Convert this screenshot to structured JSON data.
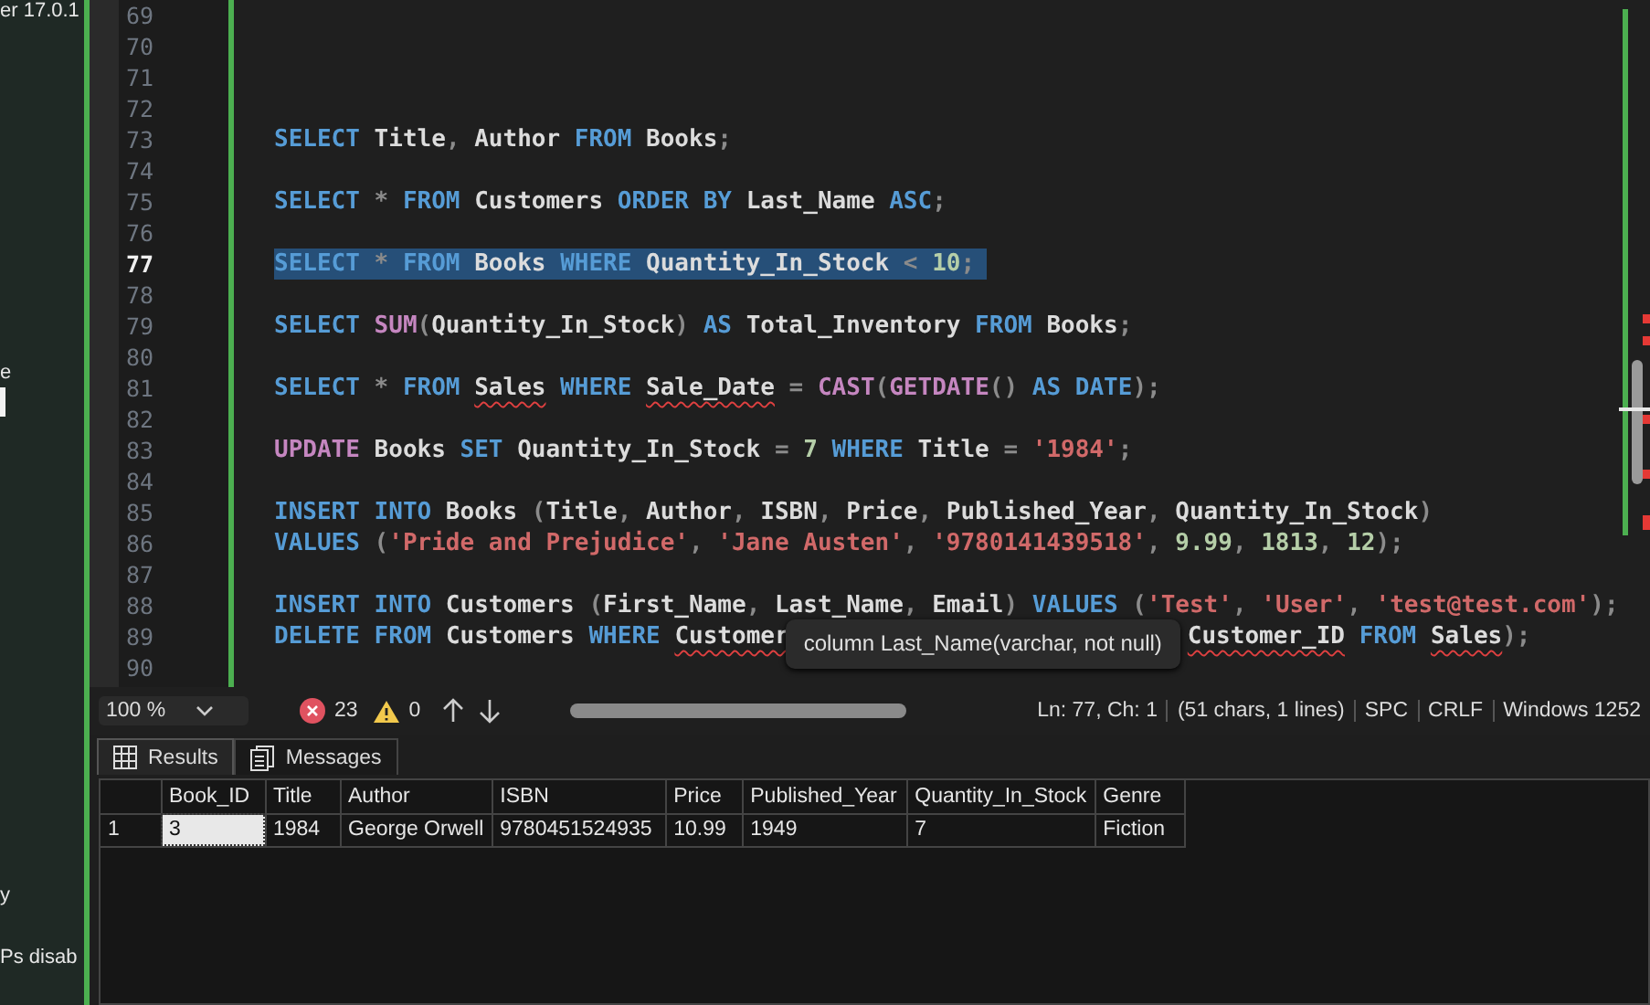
{
  "side_panel": {
    "texts": [
      "er 17.0.1",
      "e",
      "y",
      "Ps disab"
    ]
  },
  "editor": {
    "lines": [
      {
        "number": "69",
        "selected": false
      },
      {
        "number": "70",
        "selected": false
      },
      {
        "number": "71",
        "selected": false
      },
      {
        "number": "72",
        "selected": false
      },
      {
        "number": "73",
        "selected": false,
        "tokens": [
          {
            "text": "SELECT ",
            "kind": "kw"
          },
          {
            "text": "Title",
            "kind": "id"
          },
          {
            "text": ", ",
            "kind": "op"
          },
          {
            "text": "Author ",
            "kind": "id"
          },
          {
            "text": "FROM ",
            "kind": "kw"
          },
          {
            "text": "Books",
            "kind": "id"
          },
          {
            "text": ";",
            "kind": "op"
          }
        ]
      },
      {
        "number": "74",
        "selected": false
      },
      {
        "number": "75",
        "selected": false,
        "tokens": [
          {
            "text": "SELECT ",
            "kind": "kw"
          },
          {
            "text": "* ",
            "kind": "op"
          },
          {
            "text": "FROM ",
            "kind": "kw"
          },
          {
            "text": "Customers ",
            "kind": "id"
          },
          {
            "text": "ORDER BY ",
            "kind": "kw"
          },
          {
            "text": "Last_Name ",
            "kind": "id"
          },
          {
            "text": "ASC",
            "kind": "kw"
          },
          {
            "text": ";",
            "kind": "op"
          }
        ]
      },
      {
        "number": "76",
        "selected": false
      },
      {
        "number": "77",
        "selected": true,
        "tokens": [
          {
            "text": "SELECT ",
            "kind": "kw"
          },
          {
            "text": "* ",
            "kind": "op"
          },
          {
            "text": "FROM ",
            "kind": "kw"
          },
          {
            "text": "Books ",
            "kind": "id"
          },
          {
            "text": "WHERE ",
            "kind": "kw"
          },
          {
            "text": "Quantity_In_Stock ",
            "kind": "id"
          },
          {
            "text": "< ",
            "kind": "op"
          },
          {
            "text": "10",
            "kind": "num"
          },
          {
            "text": ";",
            "kind": "op"
          }
        ]
      },
      {
        "number": "78",
        "selected": false
      },
      {
        "number": "79",
        "selected": false,
        "tokens": [
          {
            "text": "SELECT ",
            "kind": "kw"
          },
          {
            "text": "SUM",
            "kind": "fn"
          },
          {
            "text": "(",
            "kind": "op"
          },
          {
            "text": "Quantity_In_Stock",
            "kind": "id"
          },
          {
            "text": ") ",
            "kind": "op"
          },
          {
            "text": "AS ",
            "kind": "kw"
          },
          {
            "text": "Total_Inventory ",
            "kind": "id"
          },
          {
            "text": "FROM ",
            "kind": "kw"
          },
          {
            "text": "Books",
            "kind": "id"
          },
          {
            "text": ";",
            "kind": "op"
          }
        ]
      },
      {
        "number": "80",
        "selected": false
      },
      {
        "number": "81",
        "selected": false,
        "tokens": [
          {
            "text": "SELECT ",
            "kind": "kw"
          },
          {
            "text": "* ",
            "kind": "op"
          },
          {
            "text": "FROM ",
            "kind": "kw"
          },
          {
            "text": "Sales",
            "kind": "id",
            "squiggle": true
          },
          {
            "text": " WHERE ",
            "kind": "kw"
          },
          {
            "text": "Sale_Date",
            "kind": "id",
            "squiggle": true
          },
          {
            "text": " = ",
            "kind": "op"
          },
          {
            "text": "CAST",
            "kind": "fn"
          },
          {
            "text": "(",
            "kind": "op"
          },
          {
            "text": "GETDATE",
            "kind": "fn"
          },
          {
            "text": "() ",
            "kind": "op"
          },
          {
            "text": "AS DATE",
            "kind": "kw"
          },
          {
            "text": ");",
            "kind": "op"
          }
        ]
      },
      {
        "number": "82",
        "selected": false
      },
      {
        "number": "83",
        "selected": false,
        "tokens": [
          {
            "text": "UPDATE ",
            "kind": "fn"
          },
          {
            "text": "Books ",
            "kind": "id"
          },
          {
            "text": "SET ",
            "kind": "kw"
          },
          {
            "text": "Quantity_In_Stock ",
            "kind": "id"
          },
          {
            "text": "= ",
            "kind": "op"
          },
          {
            "text": "7 ",
            "kind": "num"
          },
          {
            "text": "WHERE ",
            "kind": "kw"
          },
          {
            "text": "Title ",
            "kind": "id"
          },
          {
            "text": "= ",
            "kind": "op"
          },
          {
            "text": "'1984'",
            "kind": "str"
          },
          {
            "text": ";",
            "kind": "op"
          }
        ]
      },
      {
        "number": "84",
        "selected": false
      },
      {
        "number": "85",
        "selected": false,
        "tokens": [
          {
            "text": "INSERT INTO ",
            "kind": "kw"
          },
          {
            "text": "Books ",
            "kind": "id"
          },
          {
            "text": "(",
            "kind": "op"
          },
          {
            "text": "Title",
            "kind": "id"
          },
          {
            "text": ", ",
            "kind": "op"
          },
          {
            "text": "Author",
            "kind": "id"
          },
          {
            "text": ", ",
            "kind": "op"
          },
          {
            "text": "ISBN",
            "kind": "id"
          },
          {
            "text": ", ",
            "kind": "op"
          },
          {
            "text": "Price",
            "kind": "id"
          },
          {
            "text": ", ",
            "kind": "op"
          },
          {
            "text": "Published_Year",
            "kind": "id"
          },
          {
            "text": ", ",
            "kind": "op"
          },
          {
            "text": "Quantity_In_Stock",
            "kind": "id"
          },
          {
            "text": ")",
            "kind": "op"
          }
        ]
      },
      {
        "number": "86",
        "selected": false,
        "tokens": [
          {
            "text": "VALUES ",
            "kind": "kw"
          },
          {
            "text": "(",
            "kind": "op"
          },
          {
            "text": "'Pride and Prejudice'",
            "kind": "str"
          },
          {
            "text": ", ",
            "kind": "op"
          },
          {
            "text": "'Jane Austen'",
            "kind": "str"
          },
          {
            "text": ", ",
            "kind": "op"
          },
          {
            "text": "'9780141439518'",
            "kind": "str"
          },
          {
            "text": ", ",
            "kind": "op"
          },
          {
            "text": "9.99",
            "kind": "num"
          },
          {
            "text": ", ",
            "kind": "op"
          },
          {
            "text": "1813",
            "kind": "num"
          },
          {
            "text": ", ",
            "kind": "op"
          },
          {
            "text": "12",
            "kind": "num"
          },
          {
            "text": ");",
            "kind": "op"
          }
        ]
      },
      {
        "number": "87",
        "selected": false
      },
      {
        "number": "88",
        "selected": false,
        "tokens": [
          {
            "text": "INSERT INTO ",
            "kind": "kw"
          },
          {
            "text": "Customers ",
            "kind": "id"
          },
          {
            "text": "(",
            "kind": "op"
          },
          {
            "text": "First_Name",
            "kind": "id"
          },
          {
            "text": ", ",
            "kind": "op"
          },
          {
            "text": "Last_Name",
            "kind": "id"
          },
          {
            "text": ", ",
            "kind": "op"
          },
          {
            "text": "Email",
            "kind": "id"
          },
          {
            "text": ") ",
            "kind": "op"
          },
          {
            "text": "VALUES ",
            "kind": "kw"
          },
          {
            "text": "(",
            "kind": "op"
          },
          {
            "text": "'Test'",
            "kind": "str"
          },
          {
            "text": ", ",
            "kind": "op"
          },
          {
            "text": "'User'",
            "kind": "str"
          },
          {
            "text": ", ",
            "kind": "op"
          },
          {
            "text": "'test@test.com'",
            "kind": "str"
          },
          {
            "text": ");",
            "kind": "op"
          }
        ]
      },
      {
        "number": "89",
        "selected": false,
        "tokens": [
          {
            "text": "DELETE ",
            "kind": "kw"
          },
          {
            "text": "FROM ",
            "kind": "kw"
          },
          {
            "text": "Customers ",
            "kind": "id"
          },
          {
            "text": "WHERE ",
            "kind": "kw"
          },
          {
            "text": "Customer",
            "kind": "id",
            "squiggle": true
          },
          {
            "text": "column Last_Name(varchar, not null)",
            "kind": "tooltip"
          },
          {
            "text": "Customer_ID",
            "kind": "id",
            "squiggle": true
          },
          {
            "text": " FROM ",
            "kind": "kw"
          },
          {
            "text": "Sales",
            "kind": "id",
            "squiggle": true
          },
          {
            "text": ");",
            "kind": "op"
          }
        ]
      },
      {
        "number": "90",
        "selected": false
      }
    ]
  },
  "status_bar": {
    "zoom": "100 %",
    "errors": "23",
    "warnings": "0",
    "items": [
      "Ln: 77, Ch: 1",
      "(51 chars, 1 lines)",
      "SPC",
      "CRLF",
      "Windows 1252"
    ]
  },
  "results": {
    "tabs": [
      {
        "label": "Results",
        "selected": true
      },
      {
        "label": "Messages",
        "selected": false
      }
    ],
    "columns": [
      "Book_ID",
      "Title",
      "Author",
      "ISBN",
      "Price",
      "Published_Year",
      "Quantity_In_Stock",
      "Genre"
    ],
    "rows": [
      {
        "number": "1",
        "cells": [
          {
            "text": "3",
            "selected": true
          },
          {
            "text": "1984",
            "selected": false
          },
          {
            "text": "George Orwell",
            "selected": false
          },
          {
            "text": "9780451524935",
            "selected": false
          },
          {
            "text": "10.99",
            "selected": false
          },
          {
            "text": "1949",
            "selected": false
          },
          {
            "text": "7",
            "selected": false
          },
          {
            "text": "Fiction",
            "selected": false
          }
        ]
      }
    ]
  }
}
